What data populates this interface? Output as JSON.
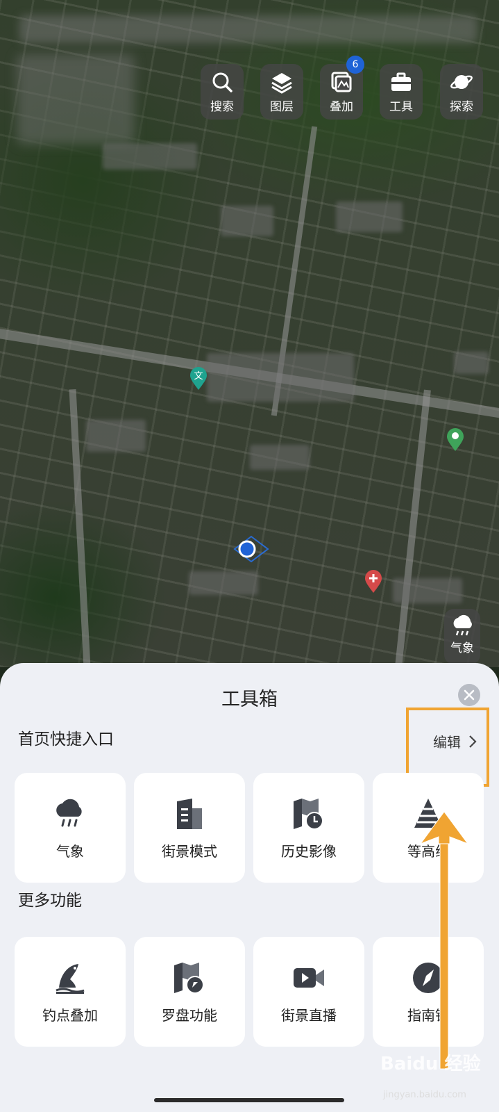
{
  "toolbar": {
    "items": [
      {
        "label": "搜索",
        "icon": "search-icon"
      },
      {
        "label": "图层",
        "icon": "layers-icon"
      },
      {
        "label": "叠加",
        "icon": "overlay-icon",
        "badge": "6"
      },
      {
        "label": "工具",
        "icon": "toolbox-icon"
      },
      {
        "label": "探索",
        "icon": "planet-icon"
      }
    ]
  },
  "map": {
    "poi_text": "文",
    "weather_button_label": "气象"
  },
  "sheet": {
    "title": "工具箱",
    "shortcut_section": "首页快捷入口",
    "edit_label": "编辑",
    "shortcuts": [
      {
        "label": "气象",
        "icon": "weather-icon"
      },
      {
        "label": "街景模式",
        "icon": "building-icon"
      },
      {
        "label": "历史影像",
        "icon": "history-map-icon"
      },
      {
        "label": "等高线",
        "icon": "contour-pyramid-icon"
      }
    ],
    "more_section": "更多功能",
    "more": [
      {
        "label": "钓点叠加",
        "icon": "fishing-icon"
      },
      {
        "label": "罗盘功能",
        "icon": "compass-map-icon"
      },
      {
        "label": "街景直播",
        "icon": "video-camera-icon"
      },
      {
        "label": "指南针",
        "icon": "compass-icon"
      }
    ]
  },
  "colors": {
    "highlight": "#f0a432",
    "badge": "#1f63d6"
  },
  "watermark": {
    "text": "Baidu 经验",
    "url": "jingyan.baidu.com"
  }
}
